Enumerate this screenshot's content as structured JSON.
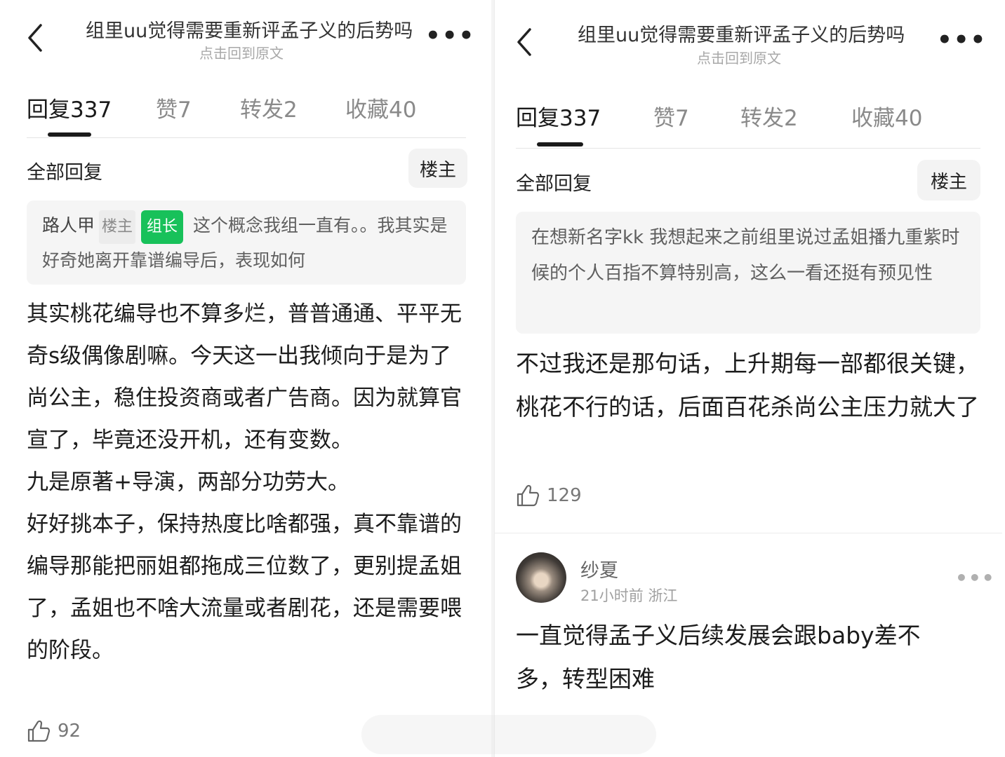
{
  "left": {
    "header": {
      "title": "组里uu觉得需要重新评孟子义的后势吗",
      "subtitle": "点击回到原文",
      "more": "•••"
    },
    "tabs": [
      {
        "label": "回复",
        "count": "337"
      },
      {
        "label": "赞",
        "count": "7"
      },
      {
        "label": "转发",
        "count": "2"
      },
      {
        "label": "收藏",
        "count": "40"
      }
    ],
    "section_title": "全部回复",
    "filter_pill": "楼主",
    "quote": {
      "name": "路人甲",
      "tag_owner": "楼主",
      "tag_role": "组长",
      "text": "这个概念我组一直有。。我其实是好奇她离开靠谱编导后，表现如何"
    },
    "body": [
      "其实桃花编导也不算多烂，普普通通、平平无奇s级偶像剧嘛。今天这一出我倾向于是为了尚公主，稳住投资商或者广告商。因为就算官宣了，毕竟还没开机，还有变数。",
      "九是原著+导演，两部分功劳大。",
      "好好挑本子，保持热度比啥都强，真不靠谱的编导那能把丽姐都拖成三位数了，更别提孟姐了，孟姐也不啥大流量或者剧花，还是需要喂的阶段。"
    ],
    "likes": "92"
  },
  "right": {
    "header": {
      "title": "组里uu觉得需要重新评孟子义的后势吗",
      "subtitle": "点击回到原文",
      "more": "•••"
    },
    "tabs": [
      {
        "label": "回复",
        "count": "337"
      },
      {
        "label": "赞",
        "count": "7"
      },
      {
        "label": "转发",
        "count": "2"
      },
      {
        "label": "收藏",
        "count": "40"
      }
    ],
    "section_title": "全部回复",
    "filter_pill": "楼主",
    "quote": {
      "text": "在想新名字kk 我想起来之前组里说过孟姐播九重紫时候的个人百指不算特别高，这么一看还挺有预见性"
    },
    "body": "不过我还是那句话，上升期每一部都很关键，桃花不行的话，后面百花杀尚公主压力就大了",
    "likes": "129",
    "comment": {
      "username": "纱夏",
      "meta": "21小时前 浙江",
      "more": "•••",
      "text": "一直觉得孟子义后续发展会跟baby差不多，转型困难"
    }
  }
}
